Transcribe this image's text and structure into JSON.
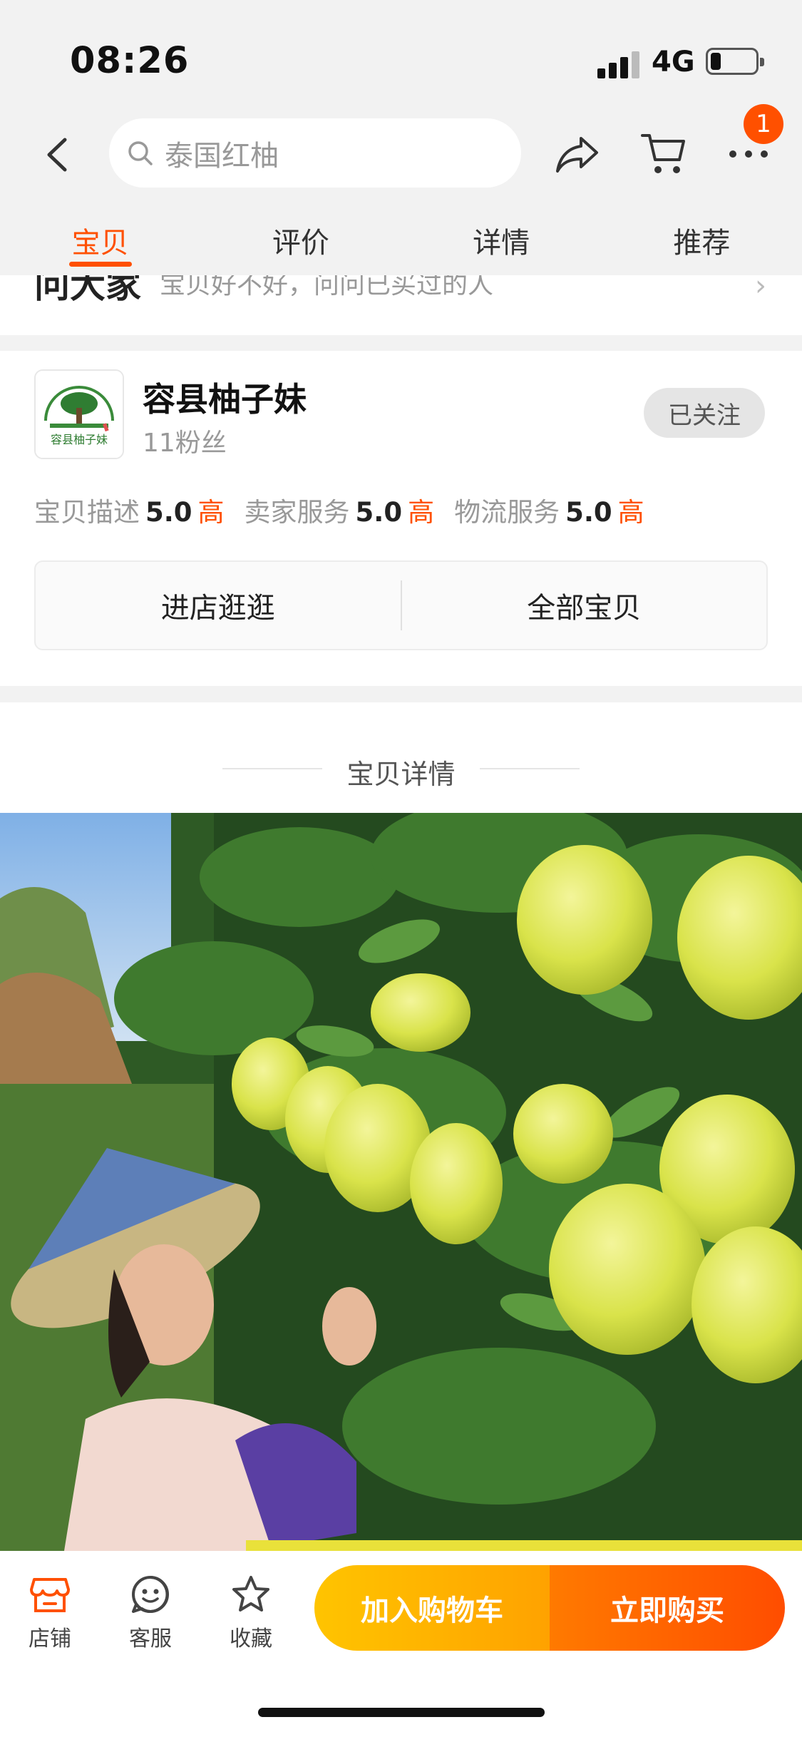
{
  "status_bar": {
    "time": "08:26",
    "network": "4G"
  },
  "nav": {
    "search_placeholder": "泰国红柚",
    "icons": [
      "back-icon",
      "search-icon",
      "share-icon",
      "cart-icon",
      "more-icon"
    ],
    "more_badge": "1"
  },
  "tabs": [
    {
      "label": "宝贝",
      "active": true
    },
    {
      "label": "评价",
      "active": false
    },
    {
      "label": "详情",
      "active": false
    },
    {
      "label": "推荐",
      "active": false
    }
  ],
  "ask": {
    "title": "问大家",
    "subtitle": "宝贝好不好，问问已买过的人"
  },
  "shop": {
    "name": "容县柚子妹",
    "fans": "11粉丝",
    "follow_label": "已关注",
    "logo_text": "容县柚子妹",
    "ratings": [
      {
        "label": "宝贝描述",
        "score": "5.0",
        "level": "高"
      },
      {
        "label": "卖家服务",
        "score": "5.0",
        "level": "高"
      },
      {
        "label": "物流服务",
        "score": "5.0",
        "level": "高"
      }
    ],
    "actions": [
      "进店逛逛",
      "全部宝贝"
    ]
  },
  "detail": {
    "title": "宝贝详情"
  },
  "bottom_bar": {
    "items": [
      {
        "label": "店铺",
        "icon": "store-icon"
      },
      {
        "label": "客服",
        "icon": "customer-service-icon"
      },
      {
        "label": "收藏",
        "icon": "star-icon"
      }
    ],
    "add_to_cart": "加入购物车",
    "buy_now": "立即购买"
  },
  "colors": {
    "accent": "#ff5000",
    "cart_yellow": "#ffb300"
  }
}
